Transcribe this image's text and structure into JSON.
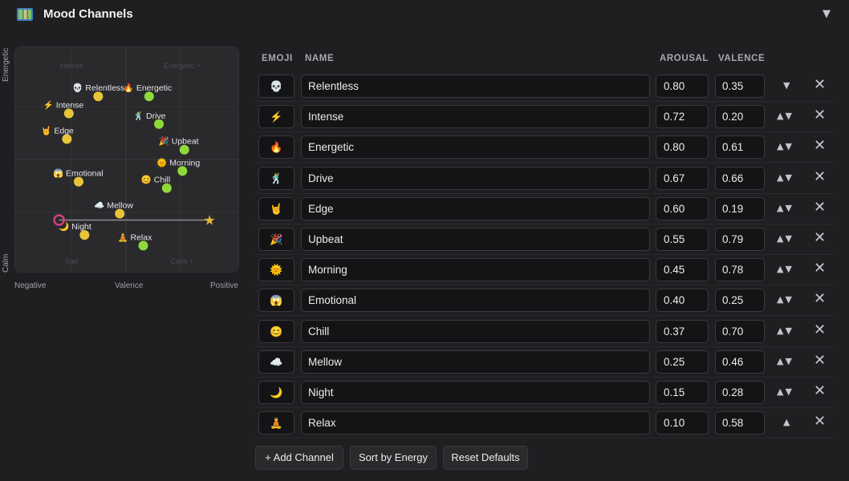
{
  "header": {
    "title": "Mood Channels",
    "collapse_glyph": "▼",
    "icon": "map-icon"
  },
  "plot": {
    "y_top_label": "Energetic",
    "y_bottom_label": "Calm",
    "x_left_label": "Negative",
    "x_center_label": "Valence",
    "x_right_label": "Positive",
    "quadrants": {
      "top_left": "Intense",
      "top_right": "Energetic +",
      "bottom_left": "Sad",
      "bottom_right": "Calm +"
    },
    "marker_colors": {
      "green": "#8fd93a",
      "yellow": "#e7c53a",
      "orange": "#f0a830",
      "star": "#e3b730",
      "target": "#d04080"
    },
    "current_position": {
      "valence": 0.15,
      "arousal": 0.22
    },
    "target_position": {
      "valence": 0.92,
      "arousal": 0.22
    }
  },
  "table": {
    "headers": {
      "emoji": "EMOJI",
      "name": "NAME",
      "arousal": "AROUSAL",
      "valence": "VALENCE"
    },
    "rows": [
      {
        "emoji": "💀",
        "name": "Relentless",
        "arousal": "0.80",
        "valence": "0.35",
        "up": "",
        "down": "▼"
      },
      {
        "emoji": "⚡",
        "name": "Intense",
        "arousal": "0.72",
        "valence": "0.20",
        "up": "▲",
        "down": "▼"
      },
      {
        "emoji": "🔥",
        "name": "Energetic",
        "arousal": "0.80",
        "valence": "0.61",
        "up": "▲",
        "down": "▼"
      },
      {
        "emoji": "🕺",
        "name": "Drive",
        "arousal": "0.67",
        "valence": "0.66",
        "up": "▲",
        "down": "▼"
      },
      {
        "emoji": "🤘",
        "name": "Edge",
        "arousal": "0.60",
        "valence": "0.19",
        "up": "▲",
        "down": "▼"
      },
      {
        "emoji": "🎉",
        "name": "Upbeat",
        "arousal": "0.55",
        "valence": "0.79",
        "up": "▲",
        "down": "▼"
      },
      {
        "emoji": "🌞",
        "name": "Morning",
        "arousal": "0.45",
        "valence": "0.78",
        "up": "▲",
        "down": "▼"
      },
      {
        "emoji": "😱",
        "name": "Emotional",
        "arousal": "0.40",
        "valence": "0.25",
        "up": "▲",
        "down": "▼"
      },
      {
        "emoji": "😊",
        "name": "Chill",
        "arousal": "0.37",
        "valence": "0.70",
        "up": "▲",
        "down": "▼"
      },
      {
        "emoji": "☁️",
        "name": "Mellow",
        "arousal": "0.25",
        "valence": "0.46",
        "up": "▲",
        "down": "▼"
      },
      {
        "emoji": "🌙",
        "name": "Night",
        "arousal": "0.15",
        "valence": "0.28",
        "up": "▲",
        "down": "▼"
      },
      {
        "emoji": "🧘",
        "name": "Relax",
        "arousal": "0.10",
        "valence": "0.58",
        "up": "▲",
        "down": ""
      }
    ],
    "delete_glyph": "✕"
  },
  "buttons": {
    "add": "+ Add Channel",
    "sort": "Sort by Energy",
    "reset": "Reset Defaults"
  }
}
